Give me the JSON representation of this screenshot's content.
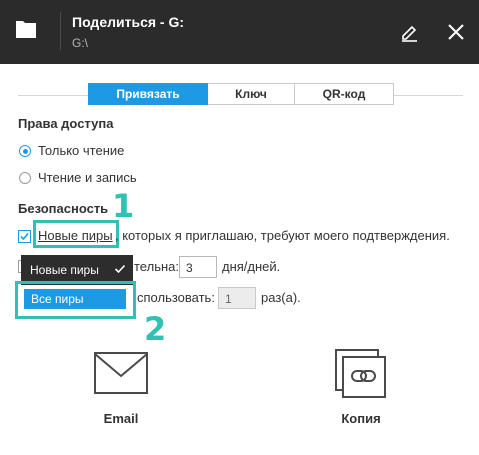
{
  "header": {
    "title": "Поделиться - G:",
    "subtitle": "G:\\",
    "icons": {
      "folder": "folder-icon",
      "edit": "pencil-icon",
      "close": "close-icon"
    }
  },
  "tabs": [
    {
      "label": "Привязать",
      "active": true
    },
    {
      "label": "Ключ",
      "active": false
    },
    {
      "label": "QR-код",
      "active": false
    }
  ],
  "access": {
    "heading": "Права доступа",
    "options": [
      {
        "label": "Только чтение",
        "selected": true
      },
      {
        "label": "Чтение и запись",
        "selected": false
      }
    ]
  },
  "security": {
    "heading": "Безопасность",
    "dropdown_selected": "Новые пиры",
    "row1_rest": ", которых я приглашаю, требуют моего подтверждения.",
    "row2_text": "тельна:",
    "row2_value": "3",
    "row2_unit": "дня/дней.",
    "row3_text": "спользовать:",
    "row3_value": "1",
    "row3_unit": "раз(а).",
    "dropdown_options": [
      {
        "label": "Новые пиры",
        "checked": true
      },
      {
        "label": "Все пиры",
        "checked": false
      }
    ]
  },
  "annotations": {
    "badge1": "1",
    "badge2": "2"
  },
  "share_targets": [
    {
      "label": "Email",
      "icon": "envelope-icon"
    },
    {
      "label": "Копия",
      "icon": "copy-link-icon"
    }
  ],
  "colors": {
    "accent": "#1e9ae5",
    "highlight": "#33c0b4",
    "header_bg": "#2b2b2b"
  }
}
